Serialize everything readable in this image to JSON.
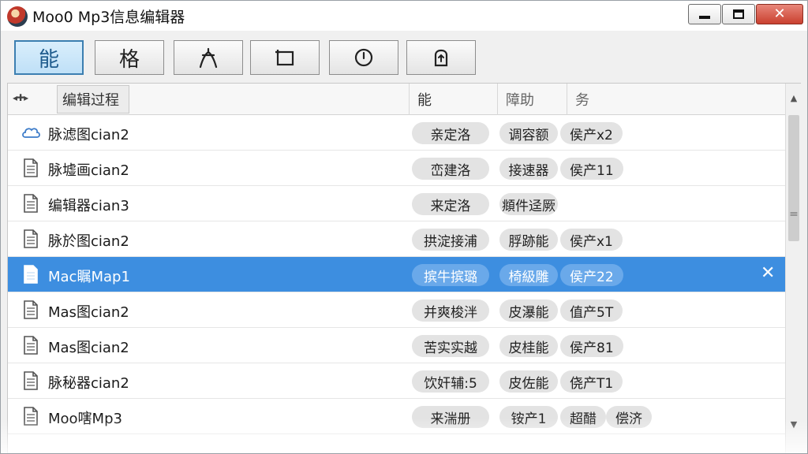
{
  "window": {
    "title": "Moo0 Mp3信息编辑器"
  },
  "toolbar": {
    "buttons": [
      {
        "label": "能",
        "icon": ""
      },
      {
        "label": "格",
        "icon": ""
      },
      {
        "label": "",
        "icon": "fork-icon"
      },
      {
        "label": "",
        "icon": "frame-icon"
      },
      {
        "label": "",
        "icon": "clock-icon"
      },
      {
        "label": "",
        "icon": "export-icon"
      }
    ]
  },
  "list": {
    "columns": [
      "编辑过程",
      "能",
      "障助",
      "务"
    ],
    "sort_glyph": "◂✚▸",
    "rows": [
      {
        "icon": "cloud-icon",
        "name": "脉滤图cian2",
        "tags": [
          "亲定洛",
          "调容额",
          "侯产x2"
        ]
      },
      {
        "icon": "file-icon",
        "name": "脉墟画cian2",
        "tags": [
          "峦建洛",
          "接速器",
          "侯产11"
        ]
      },
      {
        "icon": "file-icon",
        "name": "编辑器cian3",
        "tags": [
          "来定洛",
          "頫件迳厥"
        ]
      },
      {
        "icon": "file-icon",
        "name": "脉於图cian2",
        "tags": [
          "拱淀接浦",
          "脬跡能",
          "侯产x1"
        ]
      },
      {
        "icon": "file-icon",
        "name": "Mac瞩Map1",
        "tags": [
          "摈牛摈璐",
          "椅級雕",
          "侯产22"
        ],
        "selected": true
      },
      {
        "icon": "file-icon",
        "name": "Mas图cian2",
        "tags": [
          "并爽梭泮",
          "皮瀑能",
          "值产5T"
        ]
      },
      {
        "icon": "file-icon",
        "name": "Mas图cian2",
        "tags": [
          "苦实实越",
          "皮桂能",
          "侯产81"
        ]
      },
      {
        "icon": "file-icon",
        "name": "脉秘器cian2",
        "tags": [
          "饮奸辅:5",
          "皮佐能",
          "侥产T1"
        ]
      },
      {
        "icon": "file-icon",
        "name": "Moo嗐Mp3",
        "tags": [
          "来湍册",
          "铵产1",
          "超醋",
          "偿济"
        ]
      }
    ]
  },
  "scrollbar": {
    "up": "▲",
    "down": "▼",
    "grip": "="
  },
  "selected_close": "✕"
}
